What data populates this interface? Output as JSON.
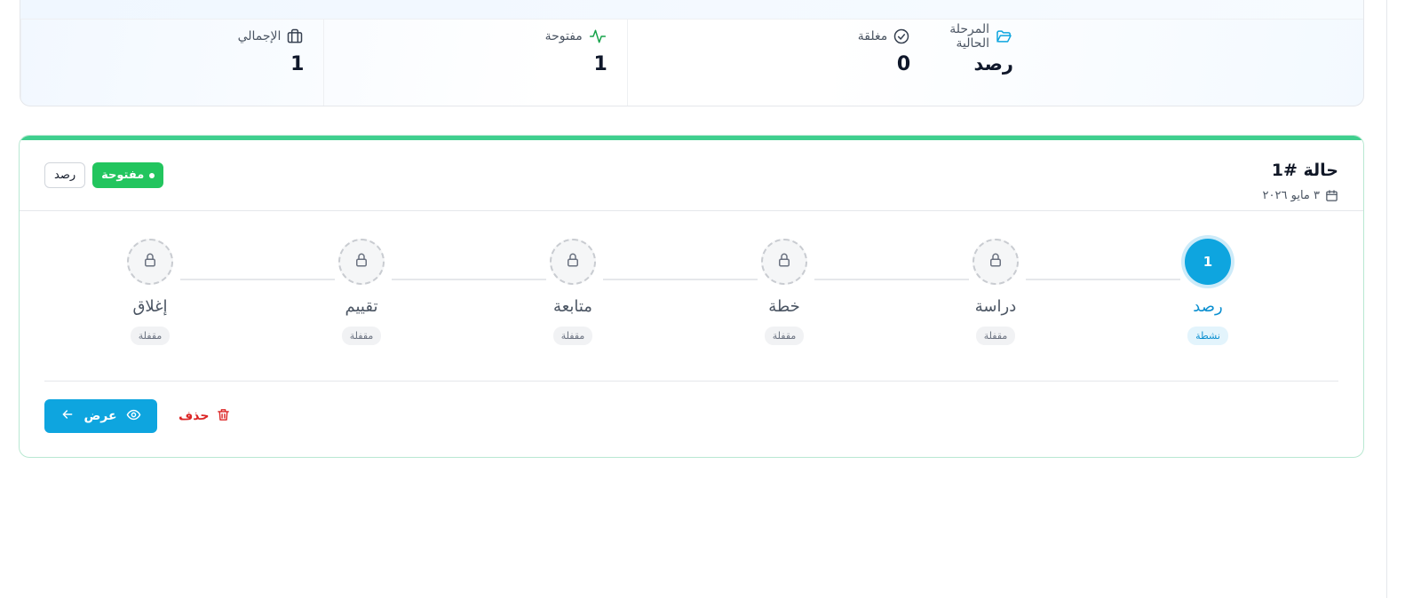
{
  "stats": {
    "items": [
      {
        "label": "الإجمالي",
        "value": "1",
        "icon": "briefcase-icon"
      },
      {
        "label": "مفتوحة",
        "value": "1",
        "icon": "activity-icon"
      },
      {
        "label": "مغلقة",
        "value": "0",
        "icon": "check-circle-icon"
      },
      {
        "label": "المرحلة الحالية",
        "value": "رصد",
        "icon": "folder-open-icon"
      }
    ]
  },
  "case": {
    "title": "حالة #1",
    "date": "٣ مايو ٢٠٢٦",
    "status_badge": "مفتوحة",
    "stage_badge": "رصد",
    "steps": [
      {
        "number": "1",
        "name": "رصد",
        "state": "نشطة"
      },
      {
        "name": "دراسة",
        "state": "مقفلة"
      },
      {
        "name": "خطة",
        "state": "مقفلة"
      },
      {
        "name": "متابعة",
        "state": "مقفلة"
      },
      {
        "name": "تقييم",
        "state": "مقفلة"
      },
      {
        "name": "إغلاق",
        "state": "مقفلة"
      }
    ],
    "actions": {
      "view_label": "عرض",
      "delete_label": "حذف"
    }
  },
  "colors": {
    "accent": "#0ea5df",
    "success": "#22c55e",
    "danger": "#dc2626",
    "card_accent": "#3fcf8e"
  }
}
